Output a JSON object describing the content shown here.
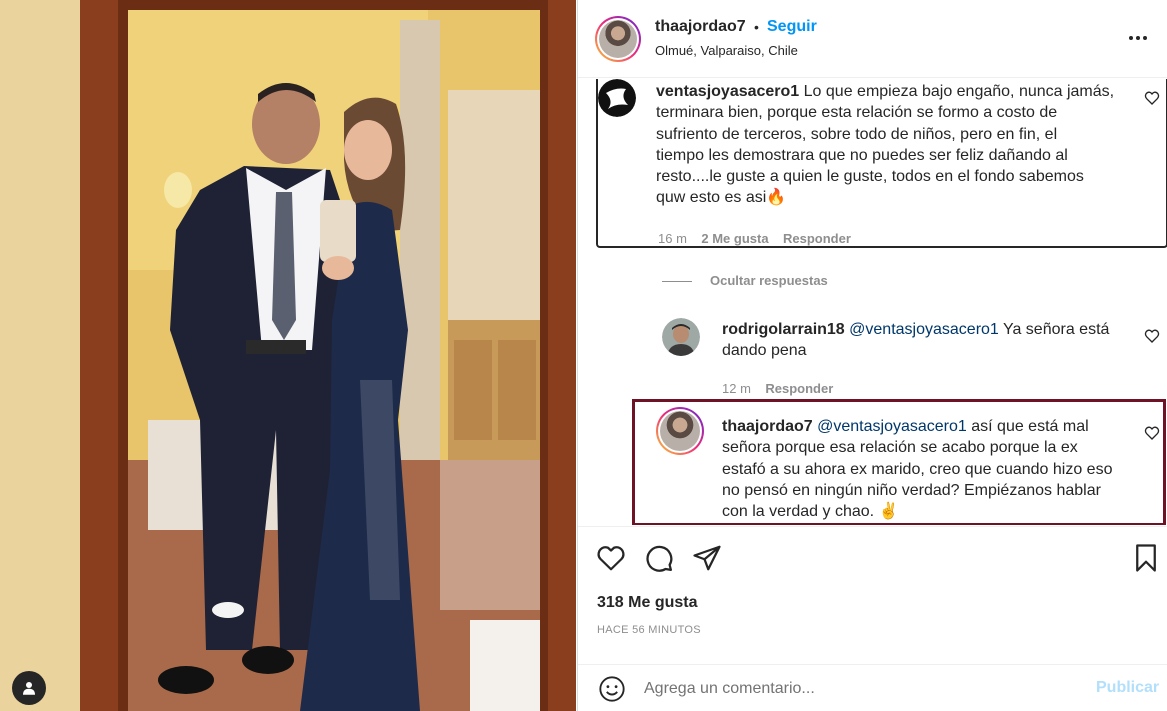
{
  "header": {
    "username": "thaajordao7",
    "separator": "•",
    "follow_label": "Seguir",
    "location": "Olmué, Valparaiso, Chile",
    "more_icon": "more-horizontal-icon"
  },
  "comments": [
    {
      "username": "ventasjoyasacero1",
      "lines": [
        "Lo que empieza bajo engaño, nunca jamás,",
        "terminara bien, porque esta relación se formo a costo de",
        "sufriento de terceros, sobre todo de niños, pero en fin, el",
        "tiempo les demostrara que no puedes ser feliz dañando al",
        "resto....le guste a quien le guste, todos en el fondo sabemos",
        "quw esto es asi🔥"
      ],
      "time": "16 m",
      "likes": "2 Me gusta",
      "reply": "Responder"
    }
  ],
  "hide_replies": "Ocultar respuestas",
  "replies": [
    {
      "username": "rodrigolarrain18",
      "mention": "@ventasjoyasacero1",
      "line1": "Ya señora está",
      "line2": "dando pena",
      "time": "12 m",
      "reply": "Responder"
    },
    {
      "username": "thaajordao7",
      "mention": "@ventasjoyasacero1",
      "line1": "así que está mal",
      "lines": [
        "señora porque esa relación se acabo porque la ex",
        "estafó a su ahora ex marido, creo que cuando hizo eso",
        "no pensó en ningún niño verdad? Empiézanos hablar",
        "con la verdad y chao. ✌️"
      ]
    }
  ],
  "actions": {
    "likes": "318 Me gusta",
    "timestamp": "HACE 56 MINUTOS"
  },
  "add_comment": {
    "placeholder": "Agrega un comentario...",
    "post_label": "Publicar"
  },
  "colors": {
    "link_blue": "#0095f6",
    "highlight_box": "#6e1325",
    "muted": "#8e8e8e"
  }
}
